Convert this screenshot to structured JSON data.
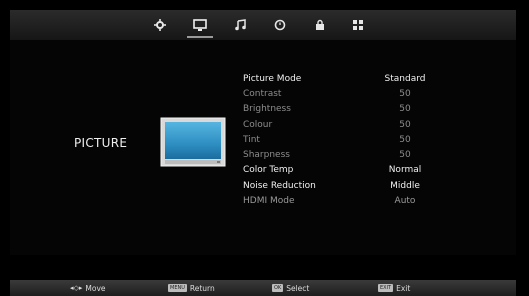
{
  "section_title": "PICTURE",
  "top_menu": {
    "icons": [
      "settings-icon",
      "picture-icon",
      "music-note-icon",
      "timer-icon",
      "lock-icon",
      "grid-icon"
    ],
    "active": "picture-icon"
  },
  "picture_menu": {
    "items": [
      {
        "label": "Picture Mode",
        "value": "Standard",
        "state": "highlight"
      },
      {
        "label": "Contrast",
        "value": "50",
        "state": "dim"
      },
      {
        "label": "Brightness",
        "value": "50",
        "state": "dim"
      },
      {
        "label": "Colour",
        "value": "50",
        "state": "dim"
      },
      {
        "label": "Tint",
        "value": "50",
        "state": "dim"
      },
      {
        "label": "Sharpness",
        "value": "50",
        "state": "dim"
      },
      {
        "label": "Color Temp",
        "value": "Normal",
        "state": "highlight"
      },
      {
        "label": "Noise Reduction",
        "value": "Middle",
        "state": "highlight"
      },
      {
        "label": "HDMI Mode",
        "value": "Auto",
        "state": "muted"
      }
    ]
  },
  "footer": {
    "move_label": "Move",
    "return_label": "Return",
    "select_label": "Select",
    "exit_label": "Exit",
    "return_key": "MENU",
    "select_key": "OK",
    "exit_key": "EXIT"
  },
  "colors": {
    "background": "#000000",
    "topbar": "#242424",
    "tv_screen": "#2f8fc0",
    "text": "#f1f1f1",
    "dim_text": "#8d8d8d"
  }
}
